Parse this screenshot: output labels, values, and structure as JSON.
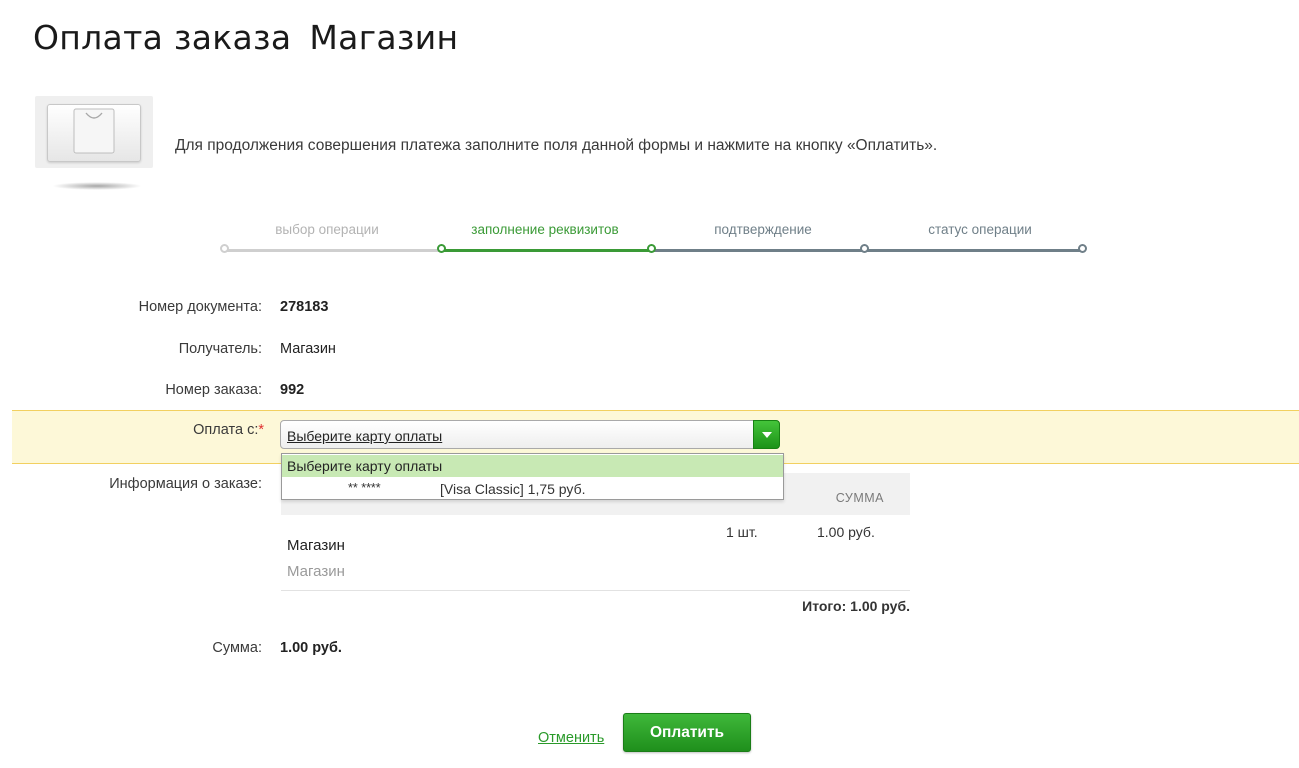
{
  "page": {
    "title": "Оплата заказа",
    "shop_name": "Магазин"
  },
  "info": {
    "text": "Для продолжения совершения платежа заполните поля данной формы и нажмите на кнопку «Оплатить».",
    "icon": "shopping-bag-card-icon"
  },
  "steps": [
    {
      "label": "выбор операции",
      "state": "done"
    },
    {
      "label": "заполнение реквизитов",
      "state": "active"
    },
    {
      "label": "подтверждение",
      "state": "pending"
    },
    {
      "label": "статус операции",
      "state": "pending"
    }
  ],
  "form": {
    "document_number": {
      "label": "Номер документа:",
      "value": "278183"
    },
    "recipient": {
      "label": "Получатель:",
      "value": "Магазин"
    },
    "order_number": {
      "label": "Номер заказа:",
      "value": "992"
    },
    "payment_from": {
      "label": "Оплата с:",
      "required_mark": "*",
      "selected": "Выберите карту оплаты",
      "options": [
        {
          "label": "Выберите карту оплаты"
        },
        {
          "mask": "** ****",
          "name": "[Visa Classic] 1,75  руб."
        }
      ]
    },
    "order_info": {
      "label": "Информация о заказе:",
      "column_sum": "СУММА",
      "items": [
        {
          "name": "Магазин",
          "description": "Магазин",
          "qty": "1 шт.",
          "price": "1.00  руб."
        }
      ],
      "total": "Итого: 1.00 руб."
    },
    "amount": {
      "label": "Сумма:",
      "value": "1.00  руб."
    }
  },
  "actions": {
    "cancel_label": "Отменить",
    "pay_label": "Оплатить"
  },
  "colors": {
    "accent_green": "#2a9a2a",
    "step_done": "#cccccc",
    "step_active": "#3a9a36",
    "step_pending": "#6f7f88",
    "highlight": "#fdf8d8"
  }
}
